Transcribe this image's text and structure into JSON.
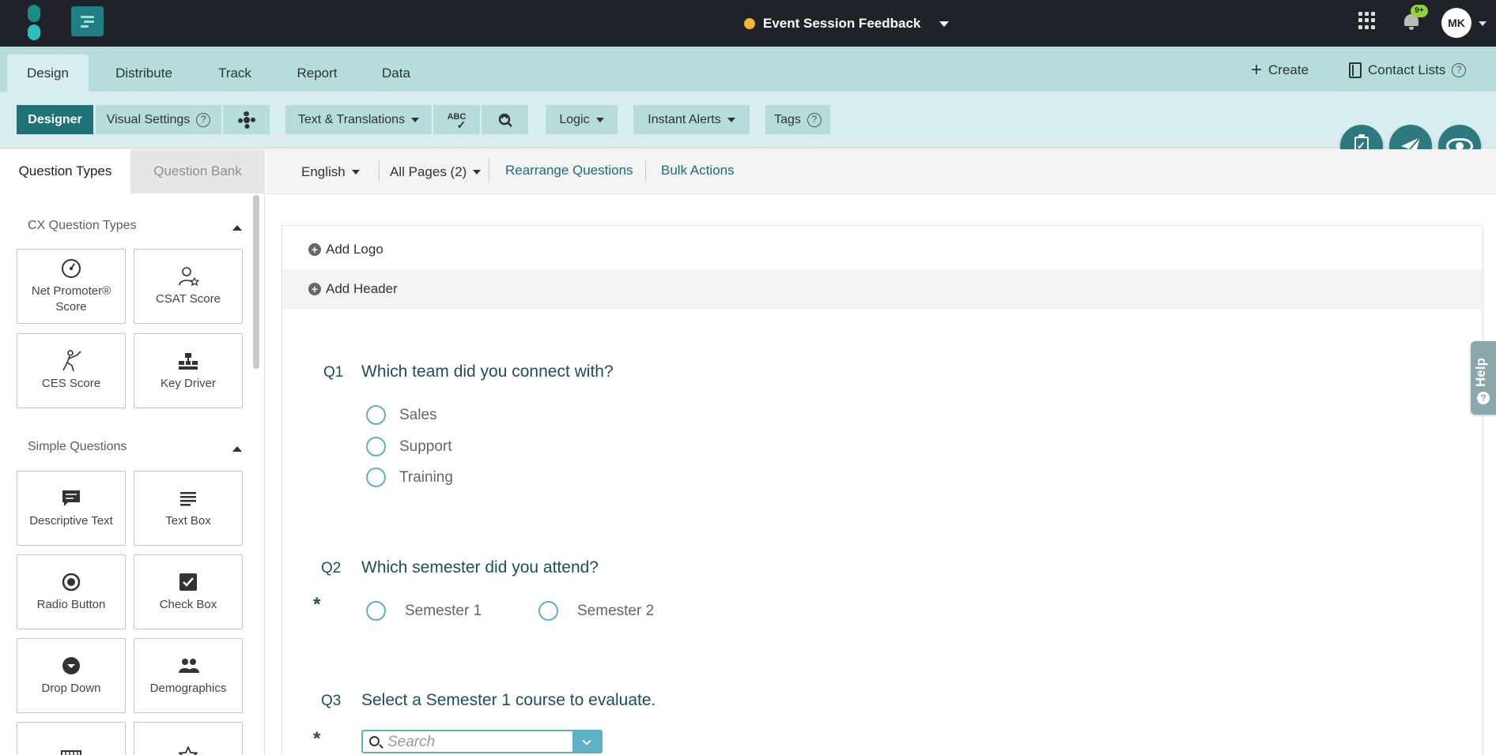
{
  "topbar": {
    "survey_title": "Event Session Feedback",
    "status_color": "#f5b731",
    "notification_badge": "9+",
    "avatar_initials": "MK"
  },
  "nav": {
    "tabs": [
      {
        "label": "Design",
        "active": true
      },
      {
        "label": "Distribute"
      },
      {
        "label": "Track"
      },
      {
        "label": "Report"
      },
      {
        "label": "Data"
      }
    ],
    "create_label": "Create",
    "contact_lists_label": "Contact Lists",
    "help_glyph": "?"
  },
  "toolbar": {
    "designer": "Designer",
    "visual_settings": "Visual Settings",
    "text_translations": "Text & Translations",
    "spellcheck": "ABC",
    "logic": "Logic",
    "instant_alerts": "Instant Alerts",
    "tags": "Tags",
    "help_glyph": "?"
  },
  "left_panel": {
    "tabs": [
      "Question Types",
      "Question Bank"
    ],
    "sections": [
      {
        "title": "CX Question Types",
        "items": [
          {
            "label": "Net Promoter® Score",
            "icon": "gauge-icon"
          },
          {
            "label": "CSAT Score",
            "icon": "person-star-icon"
          },
          {
            "label": "CES Score",
            "icon": "effort-icon"
          },
          {
            "label": "Key Driver",
            "icon": "hierarchy-icon"
          }
        ]
      },
      {
        "title": "Simple Questions",
        "items": [
          {
            "label": "Descriptive Text",
            "icon": "comment-icon"
          },
          {
            "label": "Text Box",
            "icon": "text-lines-icon"
          },
          {
            "label": "Radio Button",
            "icon": "radio-icon"
          },
          {
            "label": "Check Box",
            "icon": "checkbox-icon"
          },
          {
            "label": "Drop Down",
            "icon": "dropdown-icon"
          },
          {
            "label": "Demographics",
            "icon": "people-icon"
          }
        ]
      }
    ]
  },
  "content_tools": {
    "language": "English",
    "pages": "All Pages (2)",
    "rearrange": "Rearrange Questions",
    "bulk_actions": "Bulk Actions"
  },
  "survey": {
    "add_logo": "Add Logo",
    "add_header": "Add Header",
    "required_mark": "*",
    "questions": [
      {
        "number": "Q1",
        "text": "Which team did you connect with?",
        "options": [
          "Sales",
          "Support",
          "Training"
        ]
      },
      {
        "number": "Q2",
        "text": "Which semester did you attend?",
        "options": [
          "Semester 1",
          "Semester 2"
        ],
        "required": true
      },
      {
        "number": "Q3",
        "text": "Select a Semester 1 course to evaluate.",
        "required": true,
        "search_placeholder": "Search"
      }
    ]
  },
  "help_tab": "Help",
  "colors": {
    "topbar": "#1f2329",
    "nav": "#b7dcdc",
    "accent": "#1d7377",
    "radio": "#5eb0c4"
  }
}
